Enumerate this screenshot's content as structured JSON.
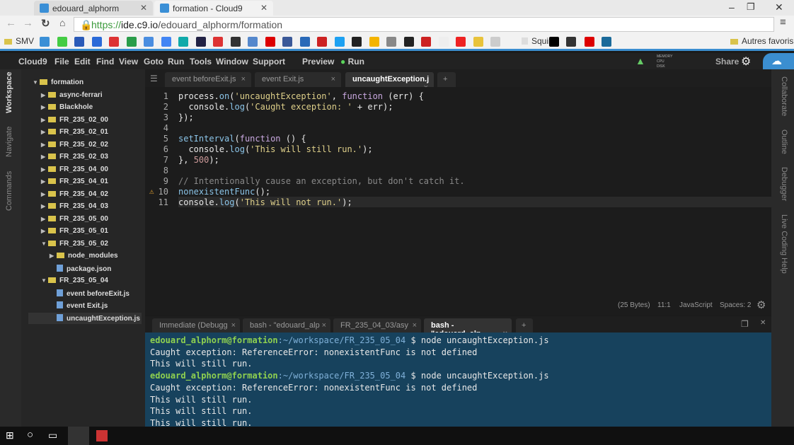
{
  "browser": {
    "tabs": [
      {
        "label": "edouard_alphorm"
      },
      {
        "label": "formation - Cloud9"
      }
    ],
    "url_scheme": "https://",
    "url_host": "ide.c9.io",
    "url_path": "/edouard_alphorm/formation",
    "bookmarks": {
      "first": "SMV",
      "squirt": "Squirt",
      "other": "Autres favoris"
    }
  },
  "menu": {
    "items": [
      "Cloud9",
      "File",
      "Edit",
      "Find",
      "View",
      "Goto",
      "Run",
      "Tools",
      "Window",
      "Support"
    ],
    "preview": "Preview",
    "run": "Run",
    "share": "Share",
    "meters": [
      "MEMORY",
      "CPU",
      "DISK"
    ]
  },
  "left_panels": [
    "Workspace",
    "Navigate",
    "Commands"
  ],
  "right_panels": [
    "Collaborate",
    "Outline",
    "Debugger",
    "Live Coding Help"
  ],
  "tree": [
    {
      "label": "formation",
      "type": "folder",
      "depth": 0,
      "open": true
    },
    {
      "label": "async-ferrari",
      "type": "folder",
      "depth": 1
    },
    {
      "label": "Blackhole",
      "type": "folder",
      "depth": 1
    },
    {
      "label": "FR_235_02_00",
      "type": "folder",
      "depth": 1
    },
    {
      "label": "FR_235_02_01",
      "type": "folder",
      "depth": 1
    },
    {
      "label": "FR_235_02_02",
      "type": "folder",
      "depth": 1
    },
    {
      "label": "FR_235_02_03",
      "type": "folder",
      "depth": 1
    },
    {
      "label": "FR_235_04_00",
      "type": "folder",
      "depth": 1
    },
    {
      "label": "FR_235_04_01",
      "type": "folder",
      "depth": 1
    },
    {
      "label": "FR_235_04_02",
      "type": "folder",
      "depth": 1
    },
    {
      "label": "FR_235_04_03",
      "type": "folder",
      "depth": 1
    },
    {
      "label": "FR_235_05_00",
      "type": "folder",
      "depth": 1
    },
    {
      "label": "FR_235_05_01",
      "type": "folder",
      "depth": 1
    },
    {
      "label": "FR_235_05_02",
      "type": "folder",
      "depth": 1,
      "open": true
    },
    {
      "label": "node_modules",
      "type": "folder",
      "depth": 2
    },
    {
      "label": "package.json",
      "type": "file",
      "depth": 2
    },
    {
      "label": "FR_235_05_04",
      "type": "folder",
      "depth": 1,
      "open": true
    },
    {
      "label": "event beforeExit.js",
      "type": "file",
      "depth": 2
    },
    {
      "label": "event Exit.js",
      "type": "file",
      "depth": 2
    },
    {
      "label": "uncaughtException.js",
      "type": "file",
      "depth": 2,
      "selected": true
    }
  ],
  "editor_tabs": [
    {
      "label": "event beforeExit.js"
    },
    {
      "label": "event Exit.js"
    },
    {
      "label": "uncaughtException.j",
      "active": true
    }
  ],
  "code": [
    "process.on('uncaughtException', function (err) {",
    "  console.log('Caught exception: ' + err);",
    "});",
    "",
    "setInterval(function () {",
    "  console.log('This will still run.');",
    "}, 500);",
    "",
    "// Intentionally cause an exception, but don't catch it.",
    "nonexistentFunc();",
    "console.log('This will not run.');"
  ],
  "warning_line": 10,
  "status": {
    "size": "(25 Bytes)",
    "pos": "11:1",
    "lang": "JavaScript",
    "spaces": "Spaces: 2"
  },
  "terminal_tabs": [
    {
      "label": "Immediate (Debugg"
    },
    {
      "label": "bash - \"edouard_alp"
    },
    {
      "label": "FR_235_04_03/asy"
    },
    {
      "label": "bash - \"edouard_alp",
      "active": true
    }
  ],
  "terminal": {
    "user": "edouard_alphorm@formation",
    "path": ":~/workspace/FR_235_05_04",
    "cmd": " $ node uncaughtException.js",
    "err": "Caught exception: ReferenceError: nonexistentFunc is not defined",
    "run": "This will still run."
  },
  "colors": {
    "accent": "#3b8ed0",
    "terminal_bg": "#17425d",
    "prompt": "#8fd14f"
  }
}
